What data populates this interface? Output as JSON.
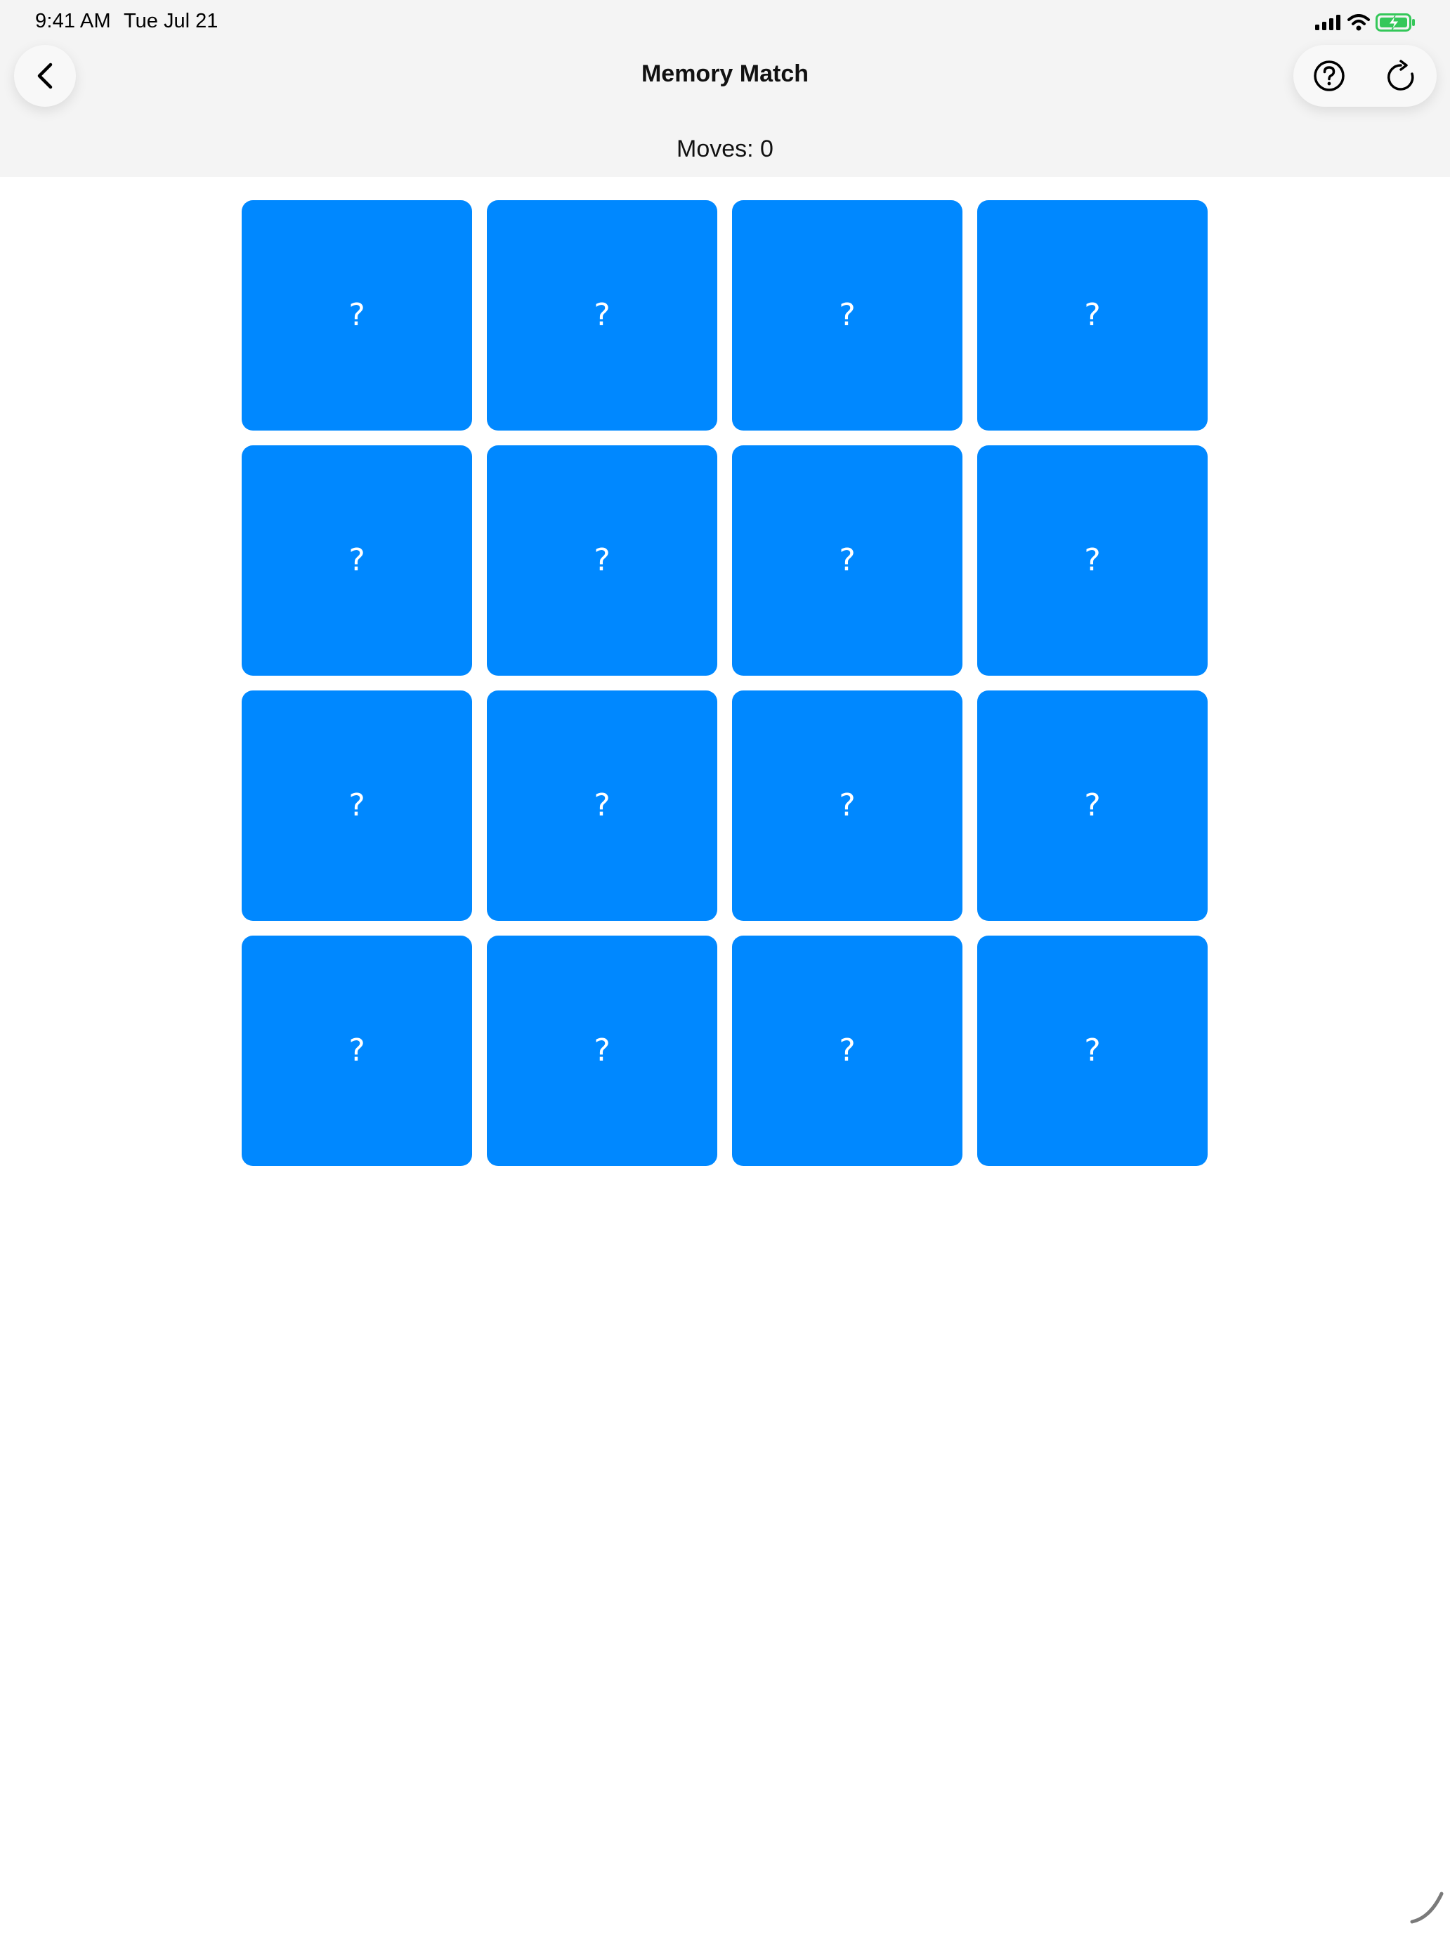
{
  "status_bar": {
    "time": "9:41 AM",
    "date": "Tue Jul 21",
    "icons": [
      "cellular-signal-icon",
      "wifi-icon",
      "battery-charging-icon"
    ]
  },
  "nav": {
    "back_icon": "chevron-left-icon",
    "title": "Memory Match",
    "help_icon": "question-circle-icon",
    "reset_icon": "arrow-clockwise-icon"
  },
  "game": {
    "moves_label": "Moves: 0",
    "moves": 0,
    "rows": 4,
    "columns": 4,
    "card_back_symbol": "?",
    "cards": [
      {
        "face": "?",
        "state": "hidden"
      },
      {
        "face": "?",
        "state": "hidden"
      },
      {
        "face": "?",
        "state": "hidden"
      },
      {
        "face": "?",
        "state": "hidden"
      },
      {
        "face": "?",
        "state": "hidden"
      },
      {
        "face": "?",
        "state": "hidden"
      },
      {
        "face": "?",
        "state": "hidden"
      },
      {
        "face": "?",
        "state": "hidden"
      },
      {
        "face": "?",
        "state": "hidden"
      },
      {
        "face": "?",
        "state": "hidden"
      },
      {
        "face": "?",
        "state": "hidden"
      },
      {
        "face": "?",
        "state": "hidden"
      },
      {
        "face": "?",
        "state": "hidden"
      },
      {
        "face": "?",
        "state": "hidden"
      },
      {
        "face": "?",
        "state": "hidden"
      },
      {
        "face": "?",
        "state": "hidden"
      }
    ]
  },
  "colors": {
    "card_back": "#0088ff",
    "header_background": "#f4f4f4",
    "battery_charging": "#34c759"
  }
}
